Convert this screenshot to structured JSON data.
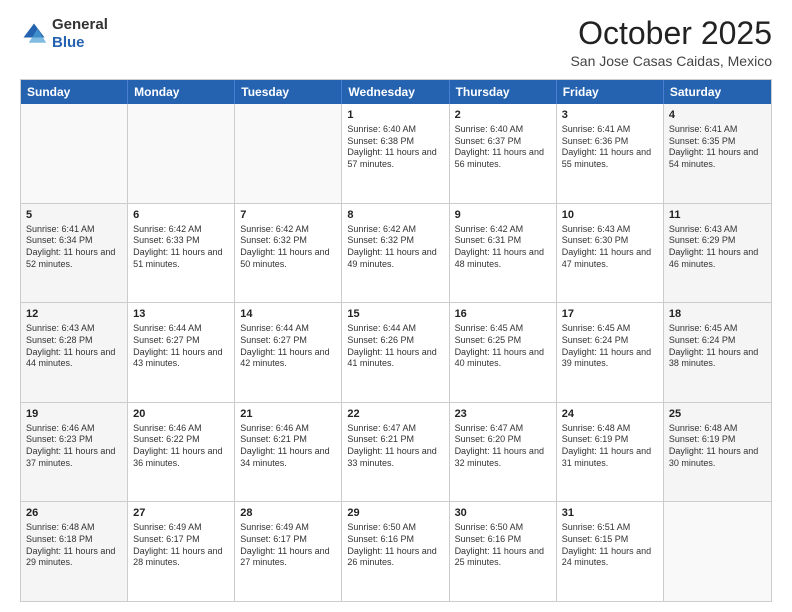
{
  "header": {
    "logo": {
      "general": "General",
      "blue": "Blue"
    },
    "title": "October 2025",
    "location": "San Jose Casas Caidas, Mexico"
  },
  "weekdays": [
    "Sunday",
    "Monday",
    "Tuesday",
    "Wednesday",
    "Thursday",
    "Friday",
    "Saturday"
  ],
  "rows": [
    [
      {
        "day": "",
        "info": "",
        "empty": true
      },
      {
        "day": "",
        "info": "",
        "empty": true
      },
      {
        "day": "",
        "info": "",
        "empty": true
      },
      {
        "day": "1",
        "info": "Sunrise: 6:40 AM\nSunset: 6:38 PM\nDaylight: 11 hours and 57 minutes."
      },
      {
        "day": "2",
        "info": "Sunrise: 6:40 AM\nSunset: 6:37 PM\nDaylight: 11 hours and 56 minutes."
      },
      {
        "day": "3",
        "info": "Sunrise: 6:41 AM\nSunset: 6:36 PM\nDaylight: 11 hours and 55 minutes."
      },
      {
        "day": "4",
        "info": "Sunrise: 6:41 AM\nSunset: 6:35 PM\nDaylight: 11 hours and 54 minutes.",
        "shaded": true
      }
    ],
    [
      {
        "day": "5",
        "info": "Sunrise: 6:41 AM\nSunset: 6:34 PM\nDaylight: 11 hours and 52 minutes.",
        "shaded": true
      },
      {
        "day": "6",
        "info": "Sunrise: 6:42 AM\nSunset: 6:33 PM\nDaylight: 11 hours and 51 minutes."
      },
      {
        "day": "7",
        "info": "Sunrise: 6:42 AM\nSunset: 6:32 PM\nDaylight: 11 hours and 50 minutes."
      },
      {
        "day": "8",
        "info": "Sunrise: 6:42 AM\nSunset: 6:32 PM\nDaylight: 11 hours and 49 minutes."
      },
      {
        "day": "9",
        "info": "Sunrise: 6:42 AM\nSunset: 6:31 PM\nDaylight: 11 hours and 48 minutes."
      },
      {
        "day": "10",
        "info": "Sunrise: 6:43 AM\nSunset: 6:30 PM\nDaylight: 11 hours and 47 minutes."
      },
      {
        "day": "11",
        "info": "Sunrise: 6:43 AM\nSunset: 6:29 PM\nDaylight: 11 hours and 46 minutes.",
        "shaded": true
      }
    ],
    [
      {
        "day": "12",
        "info": "Sunrise: 6:43 AM\nSunset: 6:28 PM\nDaylight: 11 hours and 44 minutes.",
        "shaded": true
      },
      {
        "day": "13",
        "info": "Sunrise: 6:44 AM\nSunset: 6:27 PM\nDaylight: 11 hours and 43 minutes."
      },
      {
        "day": "14",
        "info": "Sunrise: 6:44 AM\nSunset: 6:27 PM\nDaylight: 11 hours and 42 minutes."
      },
      {
        "day": "15",
        "info": "Sunrise: 6:44 AM\nSunset: 6:26 PM\nDaylight: 11 hours and 41 minutes."
      },
      {
        "day": "16",
        "info": "Sunrise: 6:45 AM\nSunset: 6:25 PM\nDaylight: 11 hours and 40 minutes."
      },
      {
        "day": "17",
        "info": "Sunrise: 6:45 AM\nSunset: 6:24 PM\nDaylight: 11 hours and 39 minutes."
      },
      {
        "day": "18",
        "info": "Sunrise: 6:45 AM\nSunset: 6:24 PM\nDaylight: 11 hours and 38 minutes.",
        "shaded": true
      }
    ],
    [
      {
        "day": "19",
        "info": "Sunrise: 6:46 AM\nSunset: 6:23 PM\nDaylight: 11 hours and 37 minutes.",
        "shaded": true
      },
      {
        "day": "20",
        "info": "Sunrise: 6:46 AM\nSunset: 6:22 PM\nDaylight: 11 hours and 36 minutes."
      },
      {
        "day": "21",
        "info": "Sunrise: 6:46 AM\nSunset: 6:21 PM\nDaylight: 11 hours and 34 minutes."
      },
      {
        "day": "22",
        "info": "Sunrise: 6:47 AM\nSunset: 6:21 PM\nDaylight: 11 hours and 33 minutes."
      },
      {
        "day": "23",
        "info": "Sunrise: 6:47 AM\nSunset: 6:20 PM\nDaylight: 11 hours and 32 minutes."
      },
      {
        "day": "24",
        "info": "Sunrise: 6:48 AM\nSunset: 6:19 PM\nDaylight: 11 hours and 31 minutes."
      },
      {
        "day": "25",
        "info": "Sunrise: 6:48 AM\nSunset: 6:19 PM\nDaylight: 11 hours and 30 minutes.",
        "shaded": true
      }
    ],
    [
      {
        "day": "26",
        "info": "Sunrise: 6:48 AM\nSunset: 6:18 PM\nDaylight: 11 hours and 29 minutes.",
        "shaded": true
      },
      {
        "day": "27",
        "info": "Sunrise: 6:49 AM\nSunset: 6:17 PM\nDaylight: 11 hours and 28 minutes."
      },
      {
        "day": "28",
        "info": "Sunrise: 6:49 AM\nSunset: 6:17 PM\nDaylight: 11 hours and 27 minutes."
      },
      {
        "day": "29",
        "info": "Sunrise: 6:50 AM\nSunset: 6:16 PM\nDaylight: 11 hours and 26 minutes."
      },
      {
        "day": "30",
        "info": "Sunrise: 6:50 AM\nSunset: 6:16 PM\nDaylight: 11 hours and 25 minutes."
      },
      {
        "day": "31",
        "info": "Sunrise: 6:51 AM\nSunset: 6:15 PM\nDaylight: 11 hours and 24 minutes."
      },
      {
        "day": "",
        "info": "",
        "empty": true,
        "shaded": true
      }
    ]
  ]
}
